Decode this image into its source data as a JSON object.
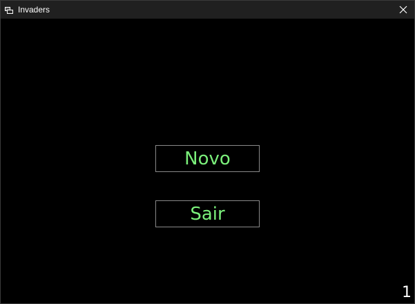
{
  "window": {
    "title": "Invaders",
    "app_icon": "invaders-app-icon",
    "close_icon": "close-icon"
  },
  "menu": {
    "new_label": "Novo",
    "exit_label": "Sair"
  },
  "status": {
    "counter": "1"
  },
  "colors": {
    "background": "#000000",
    "titlebar": "#202020",
    "button_text": "#7bf07b",
    "button_border": "#8a8a8a",
    "counter_text": "#ffffff"
  }
}
